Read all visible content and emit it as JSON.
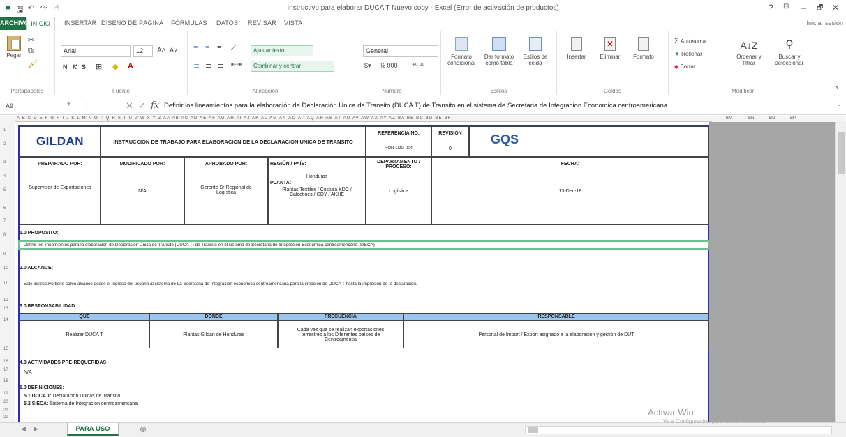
{
  "window": {
    "title": "Instructivo para elaborar DUCA T Nuevo copy - Excel (Error de activación de productos)",
    "help": "?",
    "ribbon_display": "⊡",
    "minimize": "–",
    "maximize": "🗗",
    "close": "✕",
    "quick_access": [
      "save",
      "undo",
      "redo",
      "touch"
    ]
  },
  "tabs": {
    "file": "ARCHIVO",
    "items": [
      "INICIO",
      "INSERTAR",
      "DISEÑO DE PÁGINA",
      "FÓRMULAS",
      "DATOS",
      "REVISAR",
      "VISTA"
    ],
    "sign_in": "Iniciar sesión"
  },
  "ribbon": {
    "clipboard": {
      "label": "Portapapeles",
      "paste": "Pegar"
    },
    "font": {
      "label": "Fuente",
      "name": "Arial",
      "size": "12",
      "bold": "N",
      "italic": "K",
      "underline": "S"
    },
    "alignment": {
      "label": "Alineación",
      "wrap": "Ajustar texto",
      "merge": "Combinar y centrar"
    },
    "number": {
      "label": "Número",
      "format": "General",
      "symbols": "% 000"
    },
    "styles": {
      "label": "Estilos",
      "conditional": "Formato condicional",
      "as_table": "Dar formato como tabla",
      "cell_styles": "Estilos de celda"
    },
    "cells": {
      "label": "Celdas",
      "insert": "Insertar",
      "delete": "Eliminar",
      "format": "Formato"
    },
    "editing": {
      "label": "Modificar",
      "autosum": "Autosuma",
      "fill": "Rellenar",
      "clear": "Borrar",
      "sort": "Ordenar y filtrar",
      "find": "Buscar y seleccionar"
    }
  },
  "formula_bar": {
    "name_box": "A9",
    "content": "Definir los lineamientos para la elaboración de Declaración Única de Transito (DUCA T) de Transito en el sistema de Secretaria de Integracion Economica centroamericana"
  },
  "grid": {
    "column_letters": "A B C D E F G H I J K L M N O P Q R S T U V W X Y Z AA AB AC AD AE AF AG AH AI AJ AK AL AM AN AO AP AQ AR AS AT AU AV AW AX AY AZ BA BB BC BD BE BF",
    "right_col_letters": [
      "BM",
      "BN",
      "BO",
      "BP"
    ],
    "row_numbers": [
      "1",
      "2",
      "3",
      "4",
      "5",
      "6",
      "7",
      "8",
      "9",
      "10",
      "11",
      "12",
      "13",
      "14",
      "15",
      "16",
      "17",
      "18",
      "19",
      "20",
      "21",
      "22"
    ]
  },
  "document": {
    "logo": "GILDAN",
    "header_title": "INSTRUCCION DE TRABAJO PARA ELABORACION DE LA DECLARACION UNICA DE TRANSITO",
    "ref_label": "REFERENCIA NO.",
    "ref_value": "HON-LOG-004",
    "rev_label": "REVISIÓN",
    "rev_value": "0",
    "gqs": "GQS",
    "prepared_label": "PREPARADO POR:",
    "prepared_value": "Supervisor de Exportaciones",
    "modified_label": "MODIFICADO POR:",
    "modified_value": "N/A",
    "approved_label": "APROBADO POR:",
    "approved_value": "Gerente Sr Regional de Logística",
    "region_label": "REGIÓN / PAÍS:",
    "region_value": "Honduras",
    "plant_label": "PLANTA:",
    "plant_value": "Plantas Textiles / Costura KDC / Calcetines / GDY / AKHE",
    "dept_label": "DEPARTAMENTO / PROCESO:",
    "dept_value": "Logística",
    "date_label": "FECHA:",
    "date_value": "13-Dec-18",
    "s1_title": "1.0 PROPÓSITO:",
    "s1_text": "Definir los lineamientos para la elaboración de Declaración Única de Transito (DUCA T) de Transito en el sistema de Secretaria de Integracion Economica centroamericana (SIECA)",
    "s2_title": "2.0 ALCANCE:",
    "s2_text": "Este instructivo tiene como alcance desde el ingreso del usuario al sistema de La Secretaria de Integracion economica centroamericana para la creación de DUCA T hasta la impresión de la declaración.",
    "s3_title": "3.0 RESPONSABILIDAD:",
    "resp_headers": [
      "QUÉ",
      "DÓNDE",
      "FRECUENCIA",
      "RESPONSABLE"
    ],
    "resp_row": [
      "Realizar DUCA T",
      "Plantas Gildan de Honduras",
      "Cada vez que se realizan exportaciones terrestres a los Diferentes países de Centroamérica",
      "Personal de Import / Export asignado a la elaboración y gestión de DUT"
    ],
    "s4_title": "4.0 ACTIVIDADES PRE-REQUERIDAS:",
    "s4_text": "N/A",
    "s5_title": "5.0 DEFINICIONES:",
    "def1_term": "5.1 DUCA T:",
    "def1_text": "Declaración Únicas de Transito.",
    "def2_term": "5.2 SIECA:",
    "def2_text": "Sistema de Integración centroamericana"
  },
  "sheet_tabs": {
    "active": "PARA USO",
    "add": "⊕"
  },
  "watermark": {
    "line1": "Activar Win",
    "line2": "Ve a Configuración para activar Windows."
  }
}
